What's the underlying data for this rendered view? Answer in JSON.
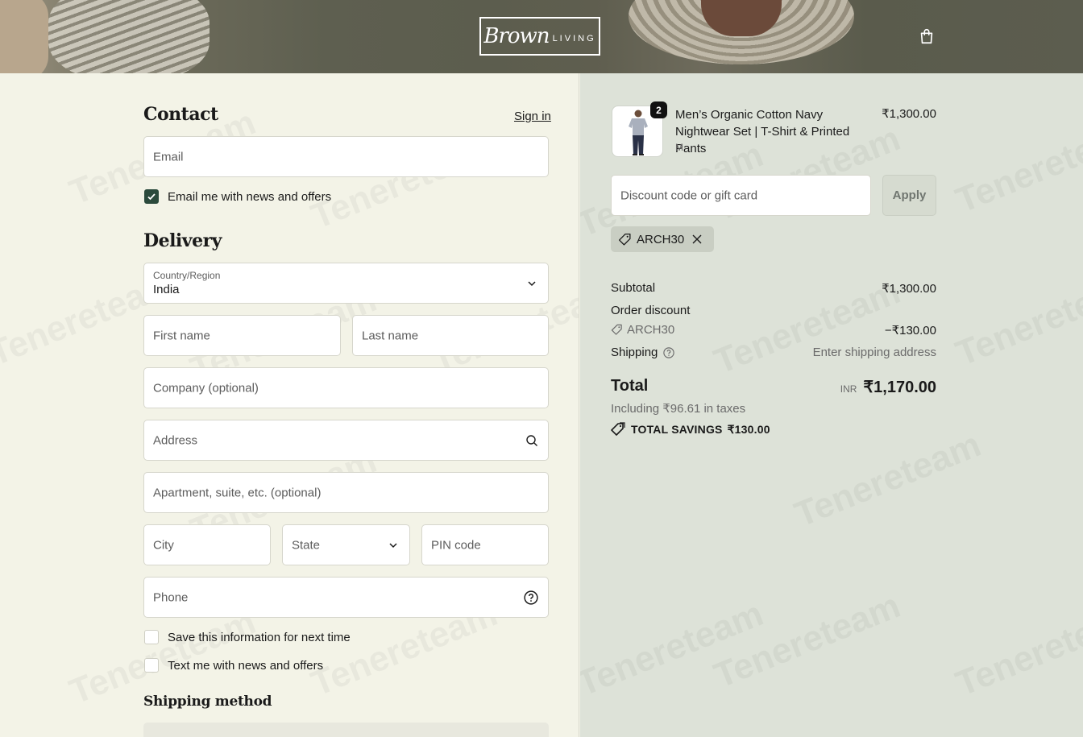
{
  "header": {
    "logo_script": "Brown",
    "logo_word": "LIVING"
  },
  "watermark": "Tenereteam",
  "contact": {
    "title": "Contact",
    "sign_in": "Sign in",
    "email_placeholder": "Email",
    "email_news_label": "Email me with news and offers",
    "email_news_checked": true
  },
  "delivery": {
    "title": "Delivery",
    "country_label": "Country/Region",
    "country_value": "India",
    "first_name": "First name",
    "last_name": "Last name",
    "company": "Company (optional)",
    "address": "Address",
    "apartment": "Apartment, suite, etc. (optional)",
    "city": "City",
    "state": "State",
    "pin": "PIN code",
    "phone": "Phone",
    "save_info_label": "Save this information for next time",
    "text_news_label": "Text me with news and offers"
  },
  "shipping_method": {
    "title": "Shipping method"
  },
  "order": {
    "product": {
      "name": "Men’s Organic Cotton Navy Nightwear Set | T-Shirt & Printed Pants",
      "variant": "M",
      "price": "₹1,300.00",
      "quantity": "2"
    },
    "discount_placeholder": "Discount code or gift card",
    "apply_label": "Apply",
    "applied_code": "ARCH30",
    "subtotal_label": "Subtotal",
    "subtotal_value": "₹1,300.00",
    "order_discount_label": "Order discount",
    "discount_code": "ARCH30",
    "discount_value": "−₹130.00",
    "shipping_label": "Shipping",
    "shipping_value": "Enter shipping address",
    "total_label": "Total",
    "currency": "INR",
    "total_value": "₹1,170.00",
    "taxes_note": "Including ₹96.61 in taxes",
    "savings_label": "TOTAL SAVINGS",
    "savings_value": "₹130.00"
  },
  "colors": {
    "left_bg": "#f3f3e7",
    "right_bg": "#dde2d8",
    "accent": "#2b4a3c"
  }
}
